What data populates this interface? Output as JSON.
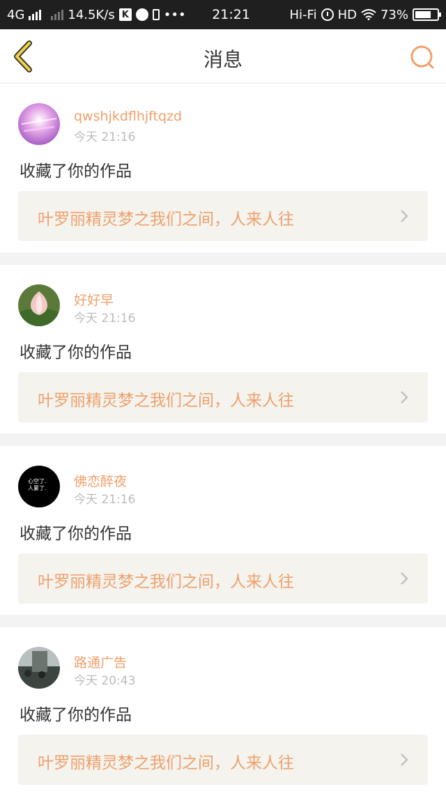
{
  "status_bar": {
    "network": "4G",
    "speed": "14.5K/s",
    "time": "21:21",
    "wifi_label": "Hi-Fi",
    "hd": "HD",
    "battery": "73%",
    "icons": [
      "signal-icon",
      "k-app-icon",
      "planet-app-icon",
      "phone-icon",
      "more-icon",
      "alarm-icon",
      "wifi-icon",
      "battery-icon"
    ]
  },
  "nav": {
    "title": "消息",
    "back_icon": "chevron-left-icon",
    "search_icon": "search-icon"
  },
  "accent_color": "#f0a06c",
  "messages": [
    {
      "username": "qwshjkdflhjftqzd",
      "time": "今天 21:16",
      "action": "收藏了你的作品",
      "work_title": "叶罗丽精灵梦之我们之间，人来人往"
    },
    {
      "username": "好好早",
      "time": "今天 21:16",
      "action": "收藏了你的作品",
      "work_title": "叶罗丽精灵梦之我们之间，人来人往"
    },
    {
      "username": "佛恋醉夜",
      "time": "今天 21:16",
      "action": "收藏了你的作品",
      "work_title": "叶罗丽精灵梦之我们之间，人来人往",
      "avatar_text": [
        "心空了.",
        "人累了."
      ]
    },
    {
      "username": "路通广告",
      "time": "今天 20:43",
      "action": "收藏了你的作品",
      "work_title": "叶罗丽精灵梦之我们之间，人来人往"
    }
  ]
}
